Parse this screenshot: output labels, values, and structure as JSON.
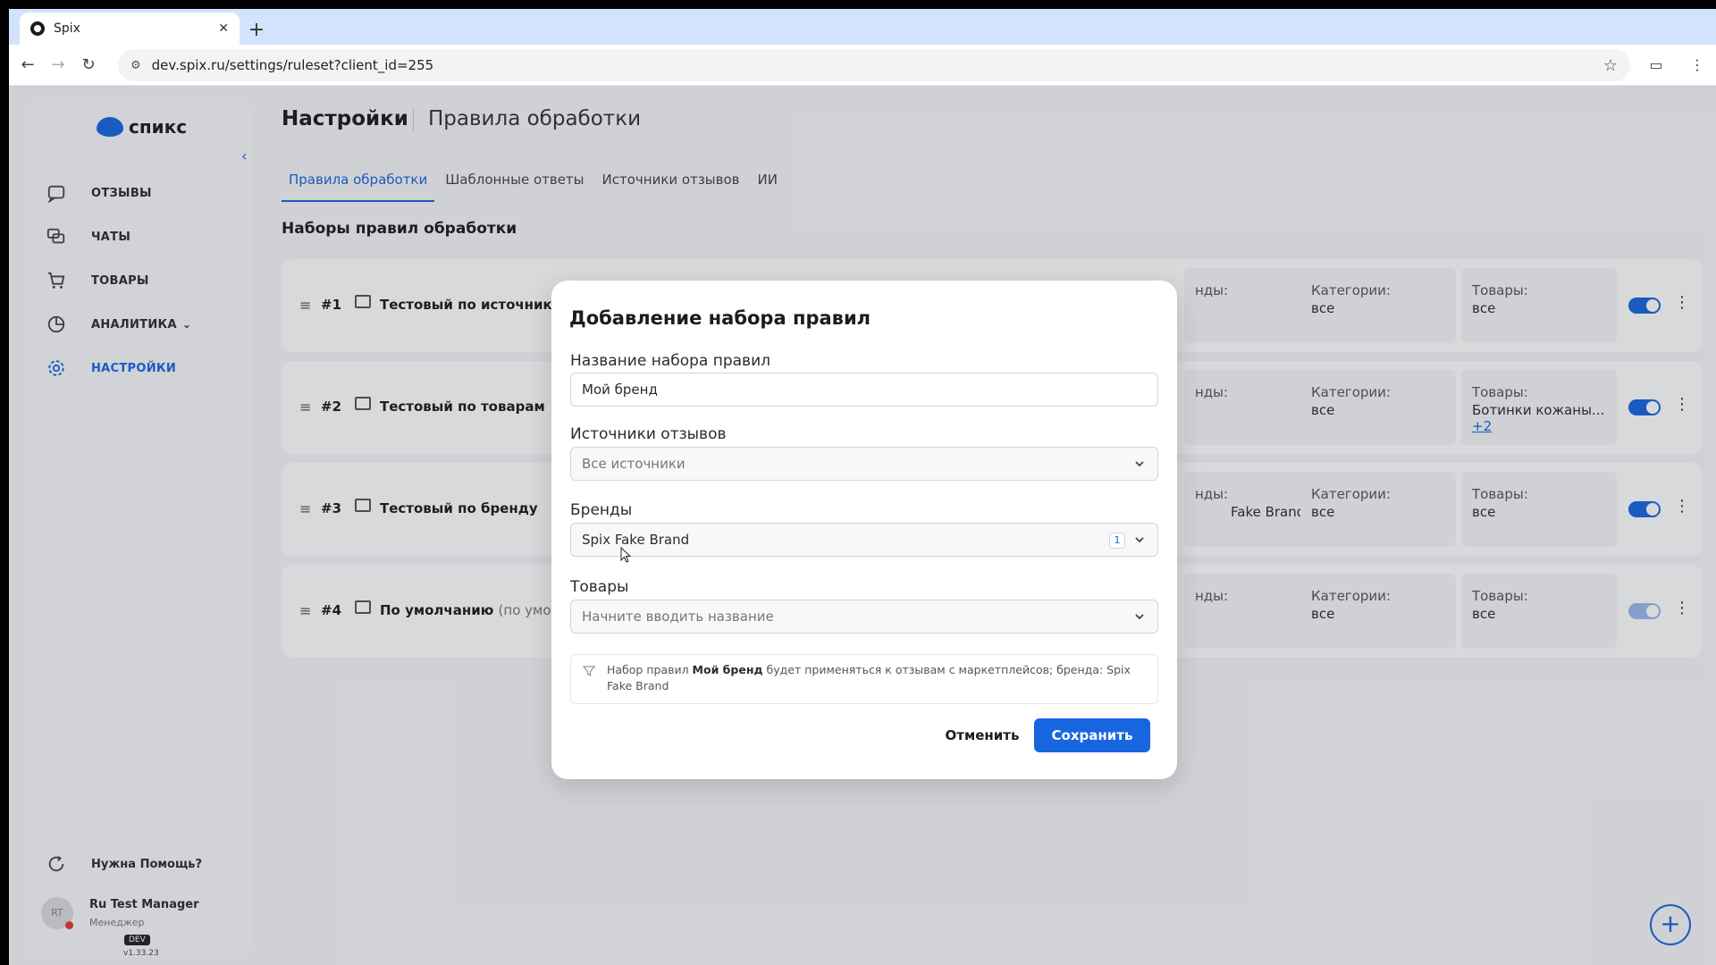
{
  "browser": {
    "tab_title": "Spix",
    "tab_close": "✕",
    "new_tab": "+",
    "url": "dev.spix.ru/settings/ruleset?client_id=255"
  },
  "sidebar": {
    "logo_text": "спикс",
    "items": [
      {
        "label": "ОТЗЫВЫ",
        "icon": "message-square-icon",
        "active": false
      },
      {
        "label": "ЧАТЫ",
        "icon": "chats-icon",
        "active": false
      },
      {
        "label": "ТОВАРЫ",
        "icon": "cart-icon",
        "active": false
      },
      {
        "label": "АНАЛИТИКА",
        "icon": "pie-chart-icon",
        "active": false
      },
      {
        "label": "НАСТРОЙКИ",
        "icon": "gear-icon",
        "active": true
      }
    ],
    "help": "Нужна Помощь?",
    "user_initials": "RT",
    "user_name": "Ru Test Manager",
    "user_role": "Менеджер",
    "env_badge": "DEV",
    "version": "v1.33.23"
  },
  "header": {
    "title": "Настройки",
    "subtitle": "Правила обработки"
  },
  "tabs": [
    "Правила обработки",
    "Шаблонные ответы",
    "Источники отзывов",
    "ИИ"
  ],
  "section_title": "Наборы правил обработки",
  "rulesets": [
    {
      "num": "#1",
      "name": "Тестовый по источнику",
      "sub": "",
      "brands_partial": "нды:",
      "categories_label": "Категории:",
      "categories": "все",
      "products_label": "Товары:",
      "products": "все",
      "more": "",
      "enabled": true
    },
    {
      "num": "#2",
      "name": "Тестовый по товарам",
      "sub": "",
      "brands_partial": "нды:",
      "categories_label": "Категории:",
      "categories": "все",
      "products_label": "Товары:",
      "products": "Ботинки кожаны...",
      "more": "+2",
      "enabled": true
    },
    {
      "num": "#3",
      "name": "Тестовый по бренду",
      "sub": "",
      "brands_partial": "нды:",
      "brands_value": "Fake Brand",
      "categories_label": "Категории:",
      "categories": "все",
      "products_label": "Товары:",
      "products": "все",
      "more": "",
      "enabled": true
    },
    {
      "num": "#4",
      "name": "По умолчанию",
      "sub": "(по умол",
      "brands_partial": "нды:",
      "categories_label": "Категории:",
      "categories": "все",
      "products_label": "Товары:",
      "products": "все",
      "more": "",
      "enabled": false
    }
  ],
  "modal": {
    "title": "Добавление набора правил",
    "name_label": "Название набора правил",
    "name_value": "Мой бренд",
    "sources_label": "Источники отзывов",
    "sources_placeholder": "Все источники",
    "brands_label": "Бренды",
    "brands_value": "Spix Fake Brand",
    "brands_count": "1",
    "products_label": "Товары",
    "products_placeholder": "Начните вводить название",
    "note_prefix": "Набор правил ",
    "note_name": "Мой бренд",
    "note_suffix": " будет применяться к отзывам с маркетплейсов; бренда: Spix Fake Brand",
    "cancel": "Отменить",
    "save": "Сохранить"
  },
  "fab": "+"
}
